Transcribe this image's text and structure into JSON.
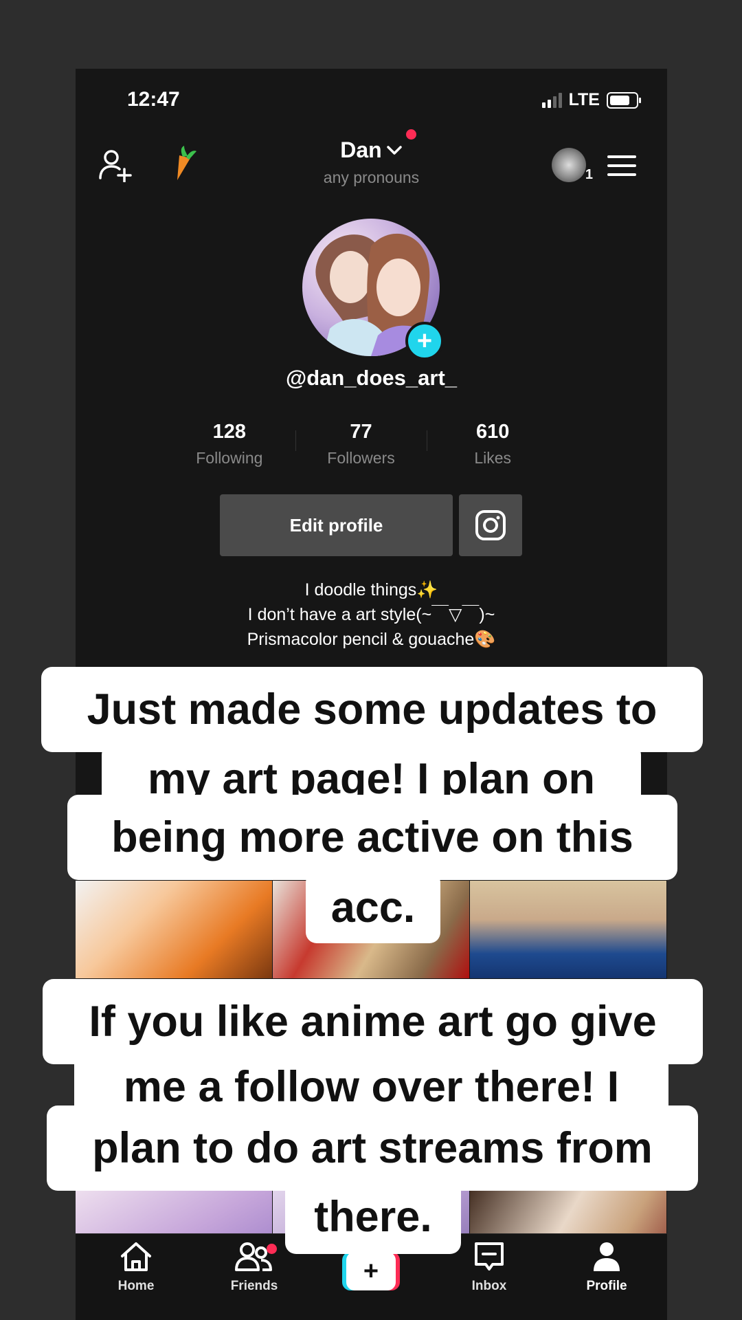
{
  "status_bar": {
    "time": "12:47",
    "network": "LTE"
  },
  "header": {
    "name": "Dan",
    "pronouns": "any pronouns",
    "notification_count": "1"
  },
  "profile": {
    "handle": "@dan_does_art_",
    "stats": [
      {
        "value": "128",
        "label": "Following"
      },
      {
        "value": "77",
        "label": "Followers"
      },
      {
        "value": "610",
        "label": "Likes"
      }
    ],
    "edit_button": "Edit profile",
    "bio": [
      "I doodle things✨",
      "I don’t have a art style(~￣▽￣)~",
      "Prismacolor pencil & gouache🎨"
    ]
  },
  "captions": [
    {
      "lines": [
        "Just made some updates to",
        "my art page!  I plan on",
        "being more active on this",
        "acc."
      ]
    },
    {
      "lines": [
        "If you like anime art go give",
        "me a follow over there! I",
        "plan to do art streams from",
        "there."
      ]
    }
  ],
  "bottom_nav": [
    {
      "label": "Home",
      "icon": "home-icon"
    },
    {
      "label": "Friends",
      "icon": "friends-icon"
    },
    {
      "label": "",
      "icon": "plus-icon"
    },
    {
      "label": "Inbox",
      "icon": "inbox-icon"
    },
    {
      "label": "Profile",
      "icon": "profile-icon"
    }
  ],
  "colors": {
    "accent_red": "#fe2c55",
    "accent_cyan": "#20d5ec",
    "background": "#161616",
    "button": "#4b4b4b"
  }
}
